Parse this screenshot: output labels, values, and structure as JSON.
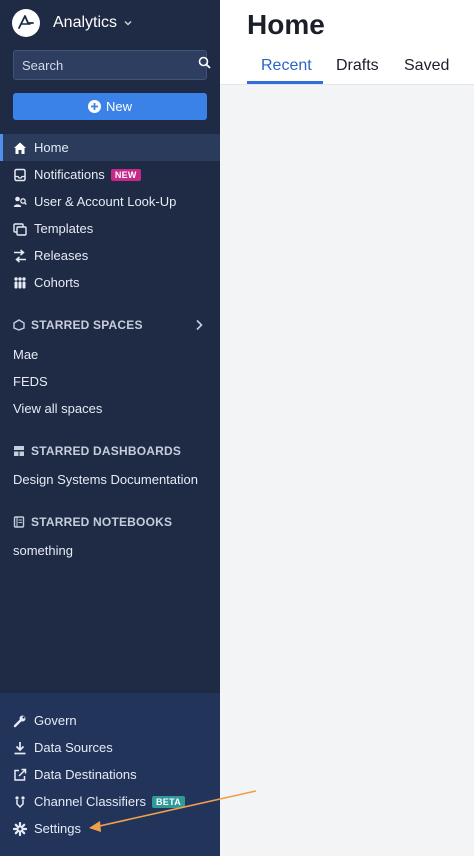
{
  "app": {
    "name": "Analytics"
  },
  "search": {
    "placeholder": "Search"
  },
  "new_button": {
    "label": "New"
  },
  "nav": [
    {
      "label": "Home",
      "icon": "home-icon",
      "active": true
    },
    {
      "label": "Notifications",
      "icon": "inbox-icon",
      "badge": "NEW"
    },
    {
      "label": "User & Account Look-Up",
      "icon": "user-search-icon"
    },
    {
      "label": "Templates",
      "icon": "templates-icon"
    },
    {
      "label": "Releases",
      "icon": "releases-icon"
    },
    {
      "label": "Cohorts",
      "icon": "cohorts-icon"
    }
  ],
  "starred_spaces": {
    "title": "STARRED SPACES",
    "items": [
      "Mae",
      "FEDS",
      "View all spaces"
    ]
  },
  "starred_dashboards": {
    "title": "STARRED DASHBOARDS",
    "items": [
      "Design Systems Documentation"
    ]
  },
  "starred_notebooks": {
    "title": "STARRED NOTEBOOKS",
    "items": [
      "something"
    ]
  },
  "footer_nav": [
    {
      "label": "Govern",
      "icon": "wrench-icon"
    },
    {
      "label": "Data Sources",
      "icon": "download-icon"
    },
    {
      "label": "Data Destinations",
      "icon": "export-icon"
    },
    {
      "label": "Channel Classifiers",
      "icon": "classifier-icon",
      "badge": "BETA"
    },
    {
      "label": "Settings",
      "icon": "gear-icon"
    }
  ],
  "main": {
    "title": "Home",
    "tabs": [
      "Recent",
      "Drafts",
      "Saved"
    ],
    "active_tab": "Recent"
  },
  "colors": {
    "sidebar": "#1f2a44",
    "sidebar_footer": "#23345a",
    "accent": "#3b82e8",
    "badge_new": "#c7288c",
    "badge_beta": "#2f9a9a",
    "annotation_arrow": "#f0a04b"
  }
}
